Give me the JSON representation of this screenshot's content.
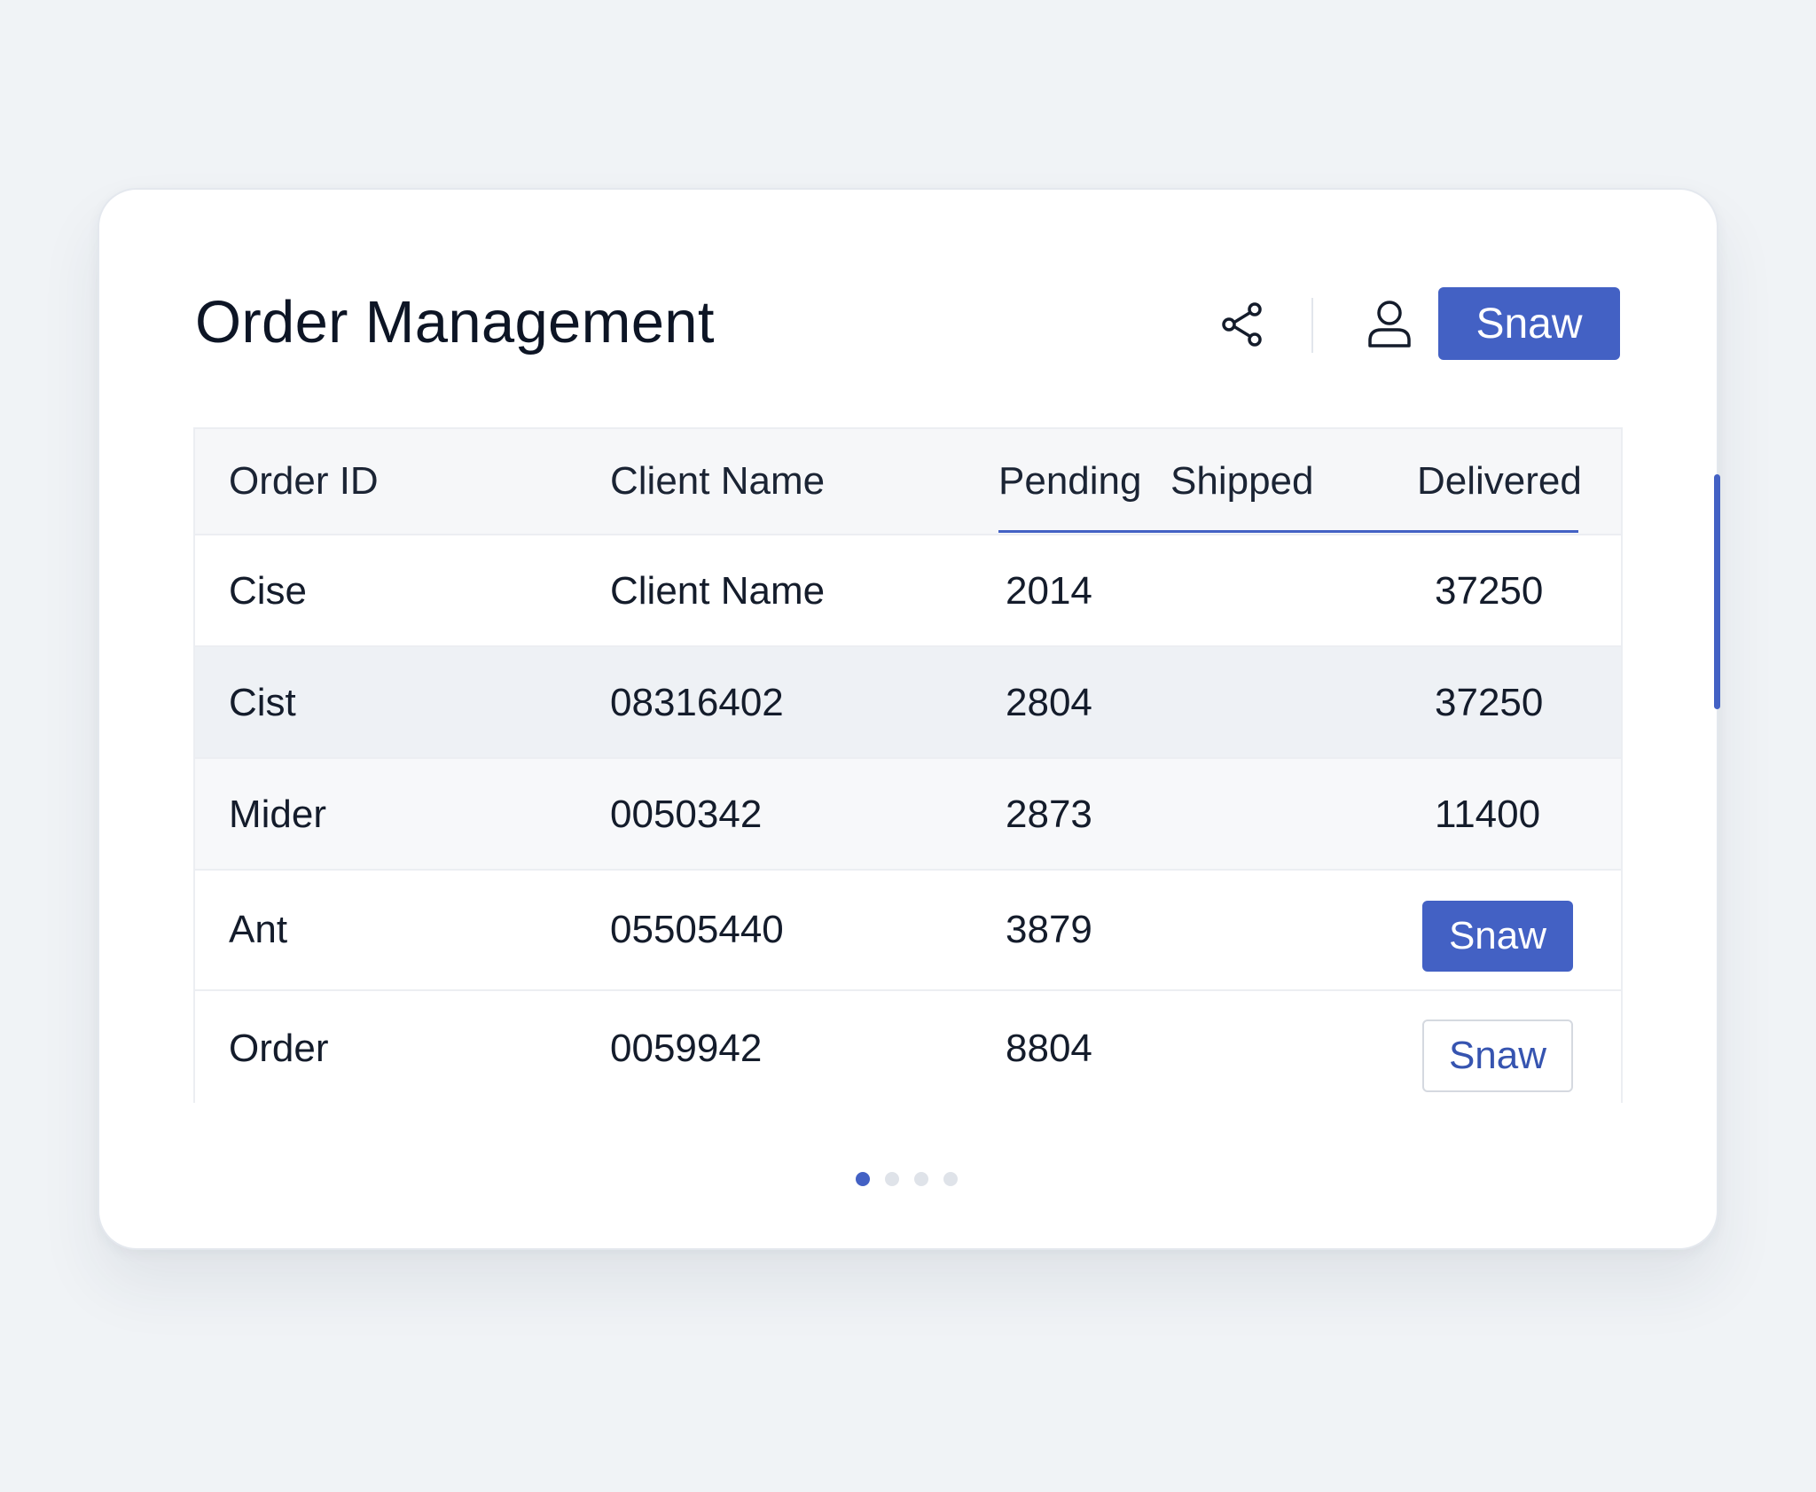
{
  "header": {
    "title": "Order Management",
    "share_icon": "share-icon",
    "user_icon": "user-icon",
    "action_label": "Snaw"
  },
  "table": {
    "columns": [
      "Order ID",
      "Client Name",
      "Pending",
      "Shipped",
      "Delivered"
    ],
    "active_tab_columns": [
      "Pending",
      "Shipped",
      "Delivered"
    ],
    "rows": [
      {
        "order_id": "Cise",
        "client": "Client Name",
        "pending": "2014",
        "delivered": "37250"
      },
      {
        "order_id": "Cist",
        "client": "08316402",
        "pending": "2804",
        "delivered": "37250"
      },
      {
        "order_id": "Mider",
        "client": "0050342",
        "pending": "2873",
        "delivered": "11400"
      },
      {
        "order_id": "Ant",
        "client": "05505440",
        "pending": "3879",
        "action": "Snaw"
      },
      {
        "order_id": "Order",
        "client": "0059942",
        "pending": "8804",
        "action": "Snaw"
      }
    ]
  },
  "pagination": {
    "pages": 4,
    "current": 1
  },
  "colors": {
    "accent": "#4361c4",
    "background": "#f0f3f6",
    "card": "#ffffff",
    "text": "#0d1525",
    "stripe": "#eef1f5"
  }
}
